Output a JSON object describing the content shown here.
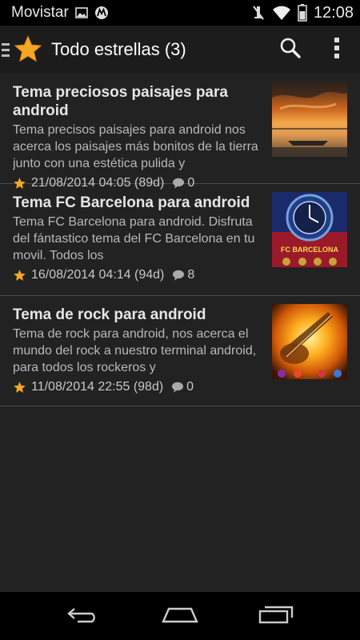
{
  "status_bar": {
    "carrier": "Movistar",
    "time": "12:08",
    "icons": [
      "image-icon",
      "motorola-icon",
      "mute-icon",
      "wifi-icon",
      "battery-icon"
    ]
  },
  "action_bar": {
    "title": "Todo estrellas (3)",
    "icons": [
      "drawer-icon",
      "star-icon",
      "search-icon",
      "overflow-menu-icon"
    ]
  },
  "items": [
    {
      "title": "Tema preciosos paisajes para android",
      "description": "Tema precisos paisajes para android nos acerca los paisajes más bonitos de la tierra junto con una estética pulida y",
      "date": "21/08/2014 04:05 (89d)",
      "comments": "0"
    },
    {
      "title": "Tema FC Barcelona para android",
      "description": "Tema FC Barcelona para android. Disfruta del fántastico tema del FC Barcelona en tu movil. Todos los",
      "date": "16/08/2014 04:14 (94d)",
      "comments": "8",
      "thumb_label": "FC BARCELONA"
    },
    {
      "title": "Tema de rock para android",
      "description": "Tema de rock para android, nos acerca el mundo del rock a nuestro terminal android, para todos los rockeros y",
      "date": "11/08/2014 22:55 (98d)",
      "comments": "0"
    }
  ],
  "nav_bar": {
    "buttons": [
      "back-icon",
      "home-icon",
      "recent-apps-icon"
    ]
  },
  "colors": {
    "star": "#f5a623",
    "background": "#222222",
    "action_bar": "#1c1c1c"
  }
}
